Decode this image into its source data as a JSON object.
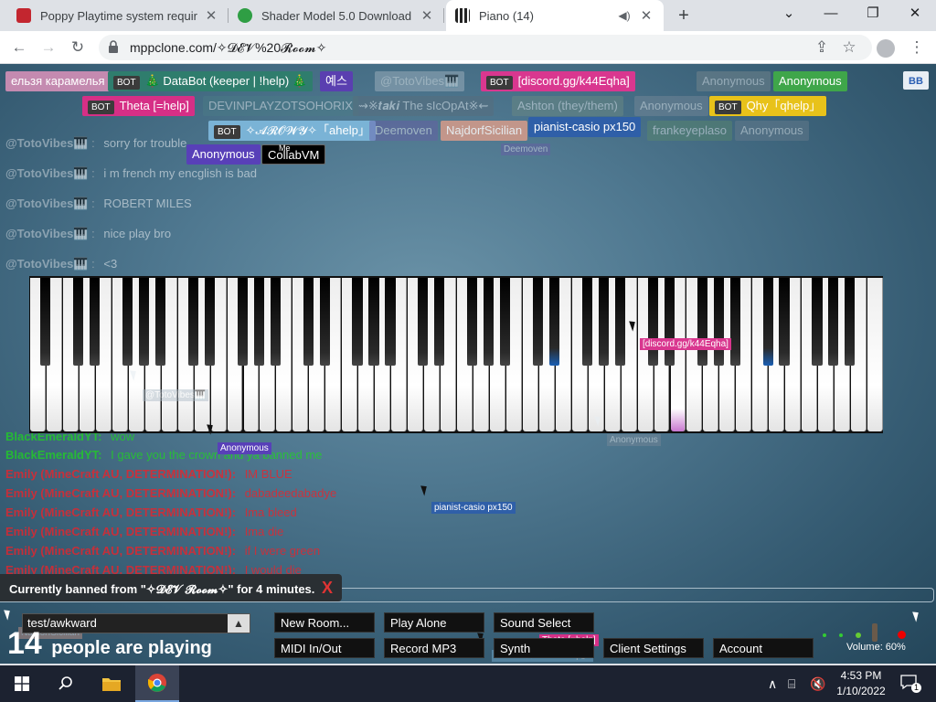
{
  "browser": {
    "tabs": [
      {
        "title": "Poppy Playtime system requirem",
        "favicon_color": "#c3262f"
      },
      {
        "title": "Shader Model 5.0 Download | Pe",
        "favicon_color": "#2f9e44"
      },
      {
        "title": "Piano (14)",
        "favicon_color": "#2b2b2b"
      }
    ],
    "new_tab": "+",
    "url": "mppclone.com/✧𝓓𝓔𝓥%20𝓡𝓸𝓸𝓶✧"
  },
  "chat": {
    "messages": [
      {
        "name": "@TotoVibes🎹",
        "text": "sorry for trouble",
        "style": "normal"
      },
      {
        "name": "@TotoVibes🎹",
        "text": "i m french my encglish is bad",
        "style": "normal"
      },
      {
        "name": "@TotoVibes🎹",
        "text": "ROBERT MILES",
        "style": "normal"
      },
      {
        "name": "@TotoVibes🎹",
        "text": "nice play bro",
        "style": "normal"
      },
      {
        "name": "@TotoVibes🎹",
        "text": "<3",
        "style": "normal"
      },
      {
        "name": "BlackEmeraldYT:",
        "text": "wow",
        "style": "green"
      },
      {
        "name": "BlackEmeraldYT:",
        "text": "I gave you the crown and ya banned me",
        "style": "green"
      },
      {
        "name": "Emily (MineCraft AU, DETERMINATION!):",
        "text": "IM BLUE",
        "style": "red"
      },
      {
        "name": "Emily (MineCraft AU, DETERMINATION!):",
        "text": "dabadeedabadye",
        "style": "red"
      },
      {
        "name": "Emily (MineCraft AU, DETERMINATION!):",
        "text": "Ima bleed",
        "style": "red"
      },
      {
        "name": "Emily (MineCraft AU, DETERMINATION!):",
        "text": "Ima die",
        "style": "red"
      },
      {
        "name": "Emily (MineCraft AU, DETERMINATION!):",
        "text": "if I were green",
        "style": "red"
      },
      {
        "name": "Emily (MineCraft AU, DETERMINATION!):",
        "text": "I would die",
        "style": "red"
      }
    ]
  },
  "users": [
    {
      "name": "ельзя карамелья",
      "color": "#c48ab0",
      "bot": false
    },
    {
      "name": "🎄 DataBot (keeper | !help) 🎄",
      "color": "#2f7d6d",
      "bot": true
    },
    {
      "name": "예스",
      "color": "#5a3fb0",
      "bot": false
    },
    {
      "name": "@TotoVibes🎹",
      "color": "#a9b8c4",
      "bot": false
    },
    {
      "name": "[discord.gg/k44Eqha]",
      "color": "#d9378f",
      "bot": true
    },
    {
      "name": "Anonymous",
      "color": "#7c8a8f",
      "bot": false
    },
    {
      "name": "Anonymous",
      "color": "#3fa64a",
      "bot": false
    },
    {
      "name": "Theta [=help]",
      "color": "#d62f86",
      "bot": true
    },
    {
      "name": "DEVINPLAYZOTSOHORIX",
      "color": "#4b7d86",
      "bot": false
    },
    {
      "name": "⇝※𝒕𝒂𝒌𝒊 The sIcOpAt※⇜",
      "color": "#5a6c7a",
      "bot": false
    },
    {
      "name": "Ashton (they/them)",
      "color": "#6f8c82",
      "bot": false
    },
    {
      "name": "Anonymous",
      "color": "#7a8a9a",
      "bot": false
    },
    {
      "name": "Qhy「qhelp」",
      "color": "#e8c21a",
      "bot": true
    },
    {
      "name": "✧𝓐𝓡𝓞𝓦𝓨✧「ahelp」",
      "color": "#7ab3d6",
      "bot": true
    },
    {
      "name": "Deemoven",
      "color": "#6a5ca8",
      "bot": false
    },
    {
      "name": "NajdorfSicilian",
      "color": "#d79c8a",
      "bot": false
    },
    {
      "name": "pianist-casio px150",
      "color": "#2f5fa8",
      "bot": false
    },
    {
      "name": "frankeyeplaso",
      "color": "#5c8a6a",
      "bot": false
    },
    {
      "name": "Anonymous",
      "color": "#6b7e8e",
      "bot": false
    },
    {
      "name": "Anonymous",
      "color": "#5840b8",
      "bot": false
    },
    {
      "name": "CollabVM",
      "color": "#000000",
      "bot": false
    }
  ],
  "bot_label": "BOT",
  "me_label": "Me",
  "top_right_button": "BB",
  "cursors": [
    {
      "label": "[discord.gg/k44Eqha]",
      "color": "#d9378f"
    },
    {
      "label": "Anonymous",
      "color": "#5840b8"
    },
    {
      "label": "pianist-casio px150",
      "color": "#2f5fa8"
    },
    {
      "label": "Anonymous",
      "color": "#7a8a9a"
    },
    {
      "label": "Deemoven",
      "color": "#6a5ca8"
    },
    {
      "label": "NajdorfSicilian",
      "color": "#d79c8a"
    },
    {
      "label": "Theta [=help]",
      "color": "#d62f86"
    },
    {
      "label": "✧𝓐𝓡𝓞𝓦𝓨✧「ahelp」",
      "color": "#7ab3d6"
    },
    {
      "label": "@TotoVibes🎹",
      "color": "#a9b8c4"
    }
  ],
  "banned_notice": "Currently banned from \"✧𝓓𝓔𝓥 𝓡𝓸𝓸𝓶✧\" for 4 minutes.",
  "banned_close": "X",
  "chat_input_value": "test/awkward",
  "chat_input_button": "▲",
  "people_count": "14",
  "people_text": "people are playing",
  "controls": {
    "new_room": "New Room...",
    "play_alone": "Play Alone",
    "sound_select": "Sound Select",
    "midi": "MIDI In/Out",
    "record": "Record MP3",
    "synth": "Synth",
    "client_settings": "Client Settings",
    "account": "Account"
  },
  "volume_label": "Volume: 60%",
  "taskbar": {
    "time": "4:53 PM",
    "date": "1/10/2022",
    "notifications": "1"
  }
}
